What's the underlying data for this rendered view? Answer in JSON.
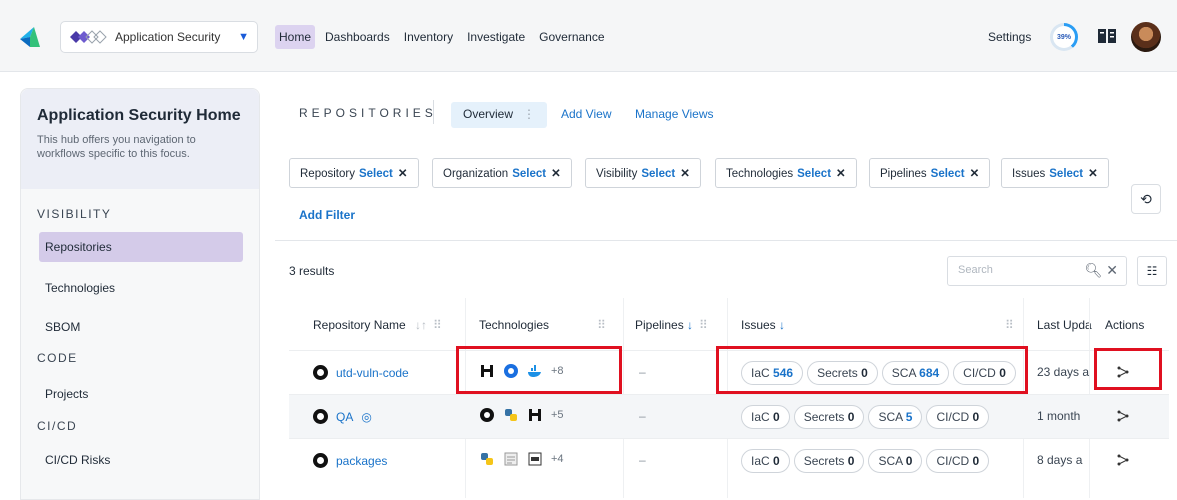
{
  "topbar": {
    "app_name": "Application Security",
    "nav": [
      "Home",
      "Dashboards",
      "Inventory",
      "Investigate",
      "Governance"
    ],
    "settings_label": "Settings",
    "progress_label": "39%",
    "progress_value": 0.39
  },
  "sidebar": {
    "title": "Application Security Home",
    "description": "This hub offers you navigation to workflows specific to this focus.",
    "sections": {
      "visibility": "VISIBILITY",
      "code": "CODE",
      "cicd": "CI/CD"
    },
    "items": {
      "repositories": "Repositories",
      "technologies": "Technologies",
      "sbom": "SBOM",
      "projects": "Projects",
      "cicd_risks": "CI/CD Risks"
    }
  },
  "main": {
    "title": "REPOSITORIES",
    "tab_overview": "Overview",
    "add_view": "Add View",
    "manage_views": "Manage Views",
    "filters": [
      {
        "label": "Repository",
        "value": "Select"
      },
      {
        "label": "Organization",
        "value": "Select"
      },
      {
        "label": "Visibility",
        "value": "Select"
      },
      {
        "label": "Technologies",
        "value": "Select"
      },
      {
        "label": "Pipelines",
        "value": "Select"
      },
      {
        "label": "Issues",
        "value": "Select"
      }
    ],
    "add_filter": "Add Filter",
    "results": "3 results",
    "search_placeholder": "Search"
  },
  "table": {
    "headers": {
      "name": "Repository Name",
      "technologies": "Technologies",
      "pipelines": "Pipelines",
      "issues": "Issues",
      "last_updated": "Last Upda",
      "actions": "Actions"
    },
    "rows": [
      {
        "name": "utd-vuln-code",
        "tech_more": "+8",
        "pipelines": "–",
        "iac_label": "IaC",
        "iac": "546",
        "secrets_label": "Secrets",
        "secrets": "0",
        "sca_label": "SCA",
        "sca": "684",
        "cicd_label": "CI/CD",
        "cicd": "0",
        "updated": "23 days a"
      },
      {
        "name": "QA",
        "tech_more": "+5",
        "pipelines": "–",
        "iac_label": "IaC",
        "iac": "0",
        "secrets_label": "Secrets",
        "secrets": "0",
        "sca_label": "SCA",
        "sca": "5",
        "cicd_label": "CI/CD",
        "cicd": "0",
        "updated": "1 month"
      },
      {
        "name": "packages",
        "tech_more": "+4",
        "pipelines": "–",
        "iac_label": "IaC",
        "iac": "0",
        "secrets_label": "Secrets",
        "secrets": "0",
        "sca_label": "SCA",
        "sca": "0",
        "cicd_label": "CI/CD",
        "cicd": "0",
        "updated": "8 days a"
      }
    ]
  },
  "colors": {
    "accent": "#1a73c9",
    "active_nav": "#dcd3f0",
    "highlight": "#e01020"
  }
}
